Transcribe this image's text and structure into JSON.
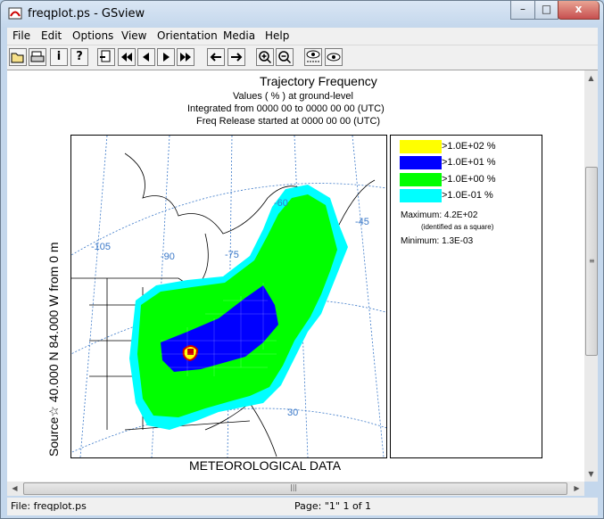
{
  "window": {
    "title": "freqplot.ps - GSview",
    "minimize": "–",
    "maximize": "□",
    "close": "x"
  },
  "menu": [
    "File",
    "Edit",
    "Options",
    "View",
    "Orientation",
    "Media",
    "Help"
  ],
  "toolbar": {
    "icons": [
      "open-icon",
      "print-icon",
      "info-icon",
      "help-icon",
      "goto-page-icon",
      "first-page-icon",
      "prev-page-icon",
      "next-page-icon",
      "last-page-icon",
      "back-icon",
      "forward-icon",
      "zoom-in-icon",
      "zoom-out-icon",
      "eye-abc-icon",
      "eye-icon"
    ],
    "info_glyph": "i",
    "help_glyph": "?"
  },
  "plot": {
    "title": "Trajectory Frequency",
    "line1": "Values  ( % ) at ground-level",
    "line2": "Integrated from 0000 00  to 0000 00  00 (UTC)",
    "line3": "Freq Release started at 0000 00  00 (UTC)",
    "ylabel": "Source☆ 40.000  N  84.000  W    from     0 m",
    "xlabel": "METEOROLOGICAL DATA",
    "lon_labels": [
      "-105",
      "-90",
      "-75",
      "-60",
      "-45"
    ],
    "lat_labels": [
      "30"
    ],
    "legend": [
      {
        "label": ">1.0E+02  %",
        "color": "#ffff00"
      },
      {
        "label": ">1.0E+01  %",
        "color": "#0000ff"
      },
      {
        "label": ">1.0E+00  %",
        "color": "#00ff00"
      },
      {
        "label": ">1.0E-01  %",
        "color": "#00ffff"
      }
    ],
    "maximum": "Maximum: 4.2E+02",
    "max_note": "(identified as a square)",
    "minimum": "Minimum: 1.3E-03"
  },
  "status": {
    "file": "File: freqplot.ps",
    "page": "Page: \"1\"  1 of 1"
  }
}
